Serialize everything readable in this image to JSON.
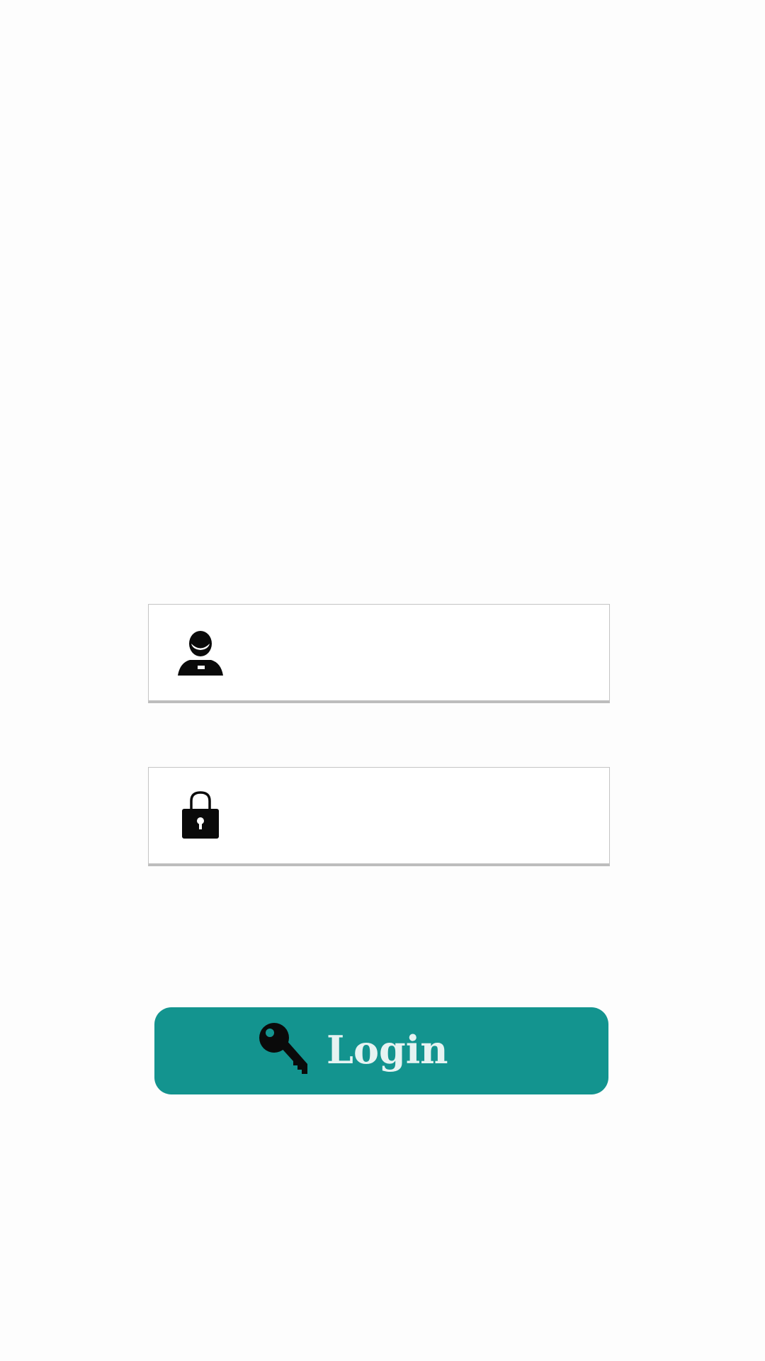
{
  "login_form": {
    "username": {
      "icon": "user-avatar-icon",
      "value": "",
      "placeholder": ""
    },
    "password": {
      "icon": "padlock-icon",
      "value": "",
      "placeholder": ""
    },
    "login_button": {
      "icon": "key-icon",
      "label": "Login"
    }
  },
  "colors": {
    "background": "#fdfdfd",
    "button_background": "#13948f",
    "button_text": "#e6f3f2",
    "field_border": "#c4c4c4"
  }
}
